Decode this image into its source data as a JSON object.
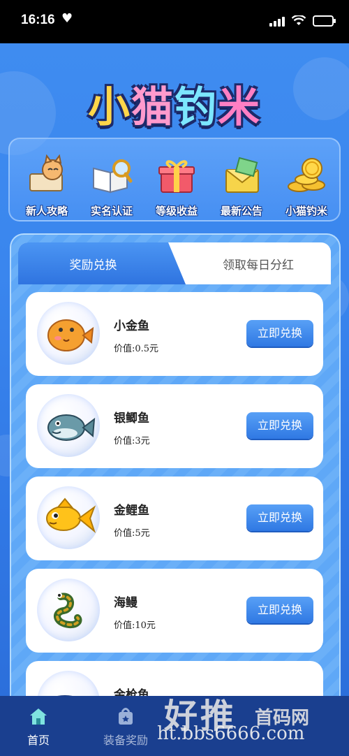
{
  "status_bar": {
    "time": "16:16"
  },
  "app": {
    "logo_text": [
      "小",
      "猫",
      "钓",
      "米"
    ]
  },
  "menu": {
    "items": [
      {
        "label": "新人攻略",
        "icon": "cat-guide-icon"
      },
      {
        "label": "实名认证",
        "icon": "book-magnifier-icon"
      },
      {
        "label": "等级收益",
        "icon": "gift-box-icon"
      },
      {
        "label": "最新公告",
        "icon": "envelope-icon"
      },
      {
        "label": "小猫钓米",
        "icon": "gold-coins-icon"
      }
    ]
  },
  "tabs": {
    "active": "奖励兑换",
    "inactive": "领取每日分红"
  },
  "rewards": [
    {
      "name": "小金鱼",
      "price": "价值:0.5元",
      "button": "立即兑换",
      "icon": "puffer-fish-icon"
    },
    {
      "name": "银鲫鱼",
      "price": "价值:3元",
      "button": "立即兑换",
      "icon": "silver-fish-icon"
    },
    {
      "name": "金鲤鱼",
      "price": "价值:5元",
      "button": "立即兑换",
      "icon": "goldfish-icon"
    },
    {
      "name": "海鳗",
      "price": "价值:10元",
      "button": "立即兑换",
      "icon": "eel-icon"
    },
    {
      "name": "金枪鱼",
      "price": "",
      "button": "",
      "icon": "tuna-icon"
    }
  ],
  "bottom_nav": [
    {
      "label": "首页",
      "icon": "home-icon",
      "active": true
    },
    {
      "label": "装备奖励",
      "icon": "gift-bag-icon",
      "active": false
    }
  ],
  "watermark": {
    "big": "好推",
    "small": "首码网",
    "url": "ht.bbs6666.com"
  },
  "colors": {
    "accent": "#2f78e3",
    "nav_bg": "#1a3f8f",
    "nav_active": "#ffffff",
    "nav_inactive": "#a9b8d8"
  }
}
